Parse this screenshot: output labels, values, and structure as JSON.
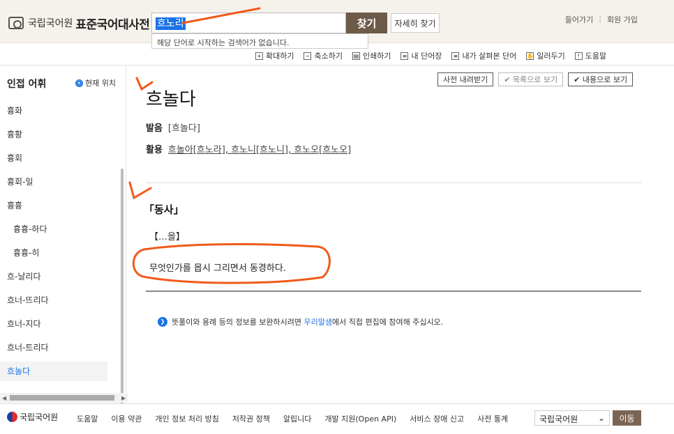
{
  "header": {
    "logo_org": "국립국어원",
    "logo_title": "표준국어대사전",
    "search_value": "흐노리",
    "search_button": "찾기",
    "advanced_button": "자세히 찾기",
    "login": "들어가기",
    "signup": "회원 가입",
    "suggestion": "해당 단어로 시작하는 검색어가 없습니다."
  },
  "toolbar": {
    "items": [
      {
        "label": "확대하기",
        "icon": "zoom-in-icon",
        "glyph": "+"
      },
      {
        "label": "축소하기",
        "icon": "zoom-out-icon",
        "glyph": "−"
      },
      {
        "label": "인쇄하기",
        "icon": "print-icon",
        "glyph": "▤"
      },
      {
        "label": "내 단어장",
        "icon": "wordbook-icon",
        "glyph": "≡"
      },
      {
        "label": "내가 살펴본 단어",
        "icon": "history-icon",
        "glyph": "≡"
      },
      {
        "label": "일러두기",
        "icon": "guide-icon",
        "glyph": "✋"
      },
      {
        "label": "도움말",
        "icon": "help-icon",
        "glyph": "!"
      }
    ]
  },
  "sidebar": {
    "title": "인접 어휘",
    "current_position": "현재 위치",
    "items": [
      {
        "label": "흉화",
        "sub": false
      },
      {
        "label": "흉황",
        "sub": false
      },
      {
        "label": "흉회",
        "sub": false
      },
      {
        "label": "흉회-일",
        "sub": false
      },
      {
        "label": "흉흉",
        "sub": false
      },
      {
        "label": "흉흉-하다",
        "sub": true
      },
      {
        "label": "흉흉-히",
        "sub": true
      },
      {
        "label": "흐-날리다",
        "sub": false
      },
      {
        "label": "흐너-뜨리다",
        "sub": false
      },
      {
        "label": "흐너-지다",
        "sub": false
      },
      {
        "label": "흐너-트리다",
        "sub": false
      },
      {
        "label": "흐놀다",
        "sub": false,
        "active": true
      }
    ]
  },
  "actions": {
    "download": "사전 내려받기",
    "list_view": "✔ 목록으로 보기",
    "content_view": "✔ 내용으로 보기"
  },
  "entry": {
    "headword": "흐놀다",
    "pron_label": "발음",
    "pron_value": "[흐놀다]",
    "conj_label": "활용",
    "conj_value": "흐놀아[흐노라], 흐노니[흐노니], 흐노오[흐노오]",
    "pos": "「동사」",
    "pattern": "【…을】",
    "definition": "무엇인가를 몹시 그리면서 동경하다."
  },
  "notice": {
    "before": "뜻풀이와 용례 등의 정보를 보완하시려면 ",
    "link": "우리말샘",
    "after": "에서 직접 편집에 참여해 주십시오."
  },
  "footer": {
    "org": "국립국어원",
    "links": [
      "도움말",
      "이용 약관",
      "개인 정보 처리 방침",
      "저작권 정책",
      "알립니다",
      "개발 지원(Open API)",
      "서비스 장애 신고",
      "사전 통계"
    ],
    "select_value": "국립국어원",
    "go_button": "이동"
  },
  "colors": {
    "brand_brown": "#6e5a48",
    "link_blue": "#1a73e8",
    "annotation_orange": "#f05a1a"
  }
}
